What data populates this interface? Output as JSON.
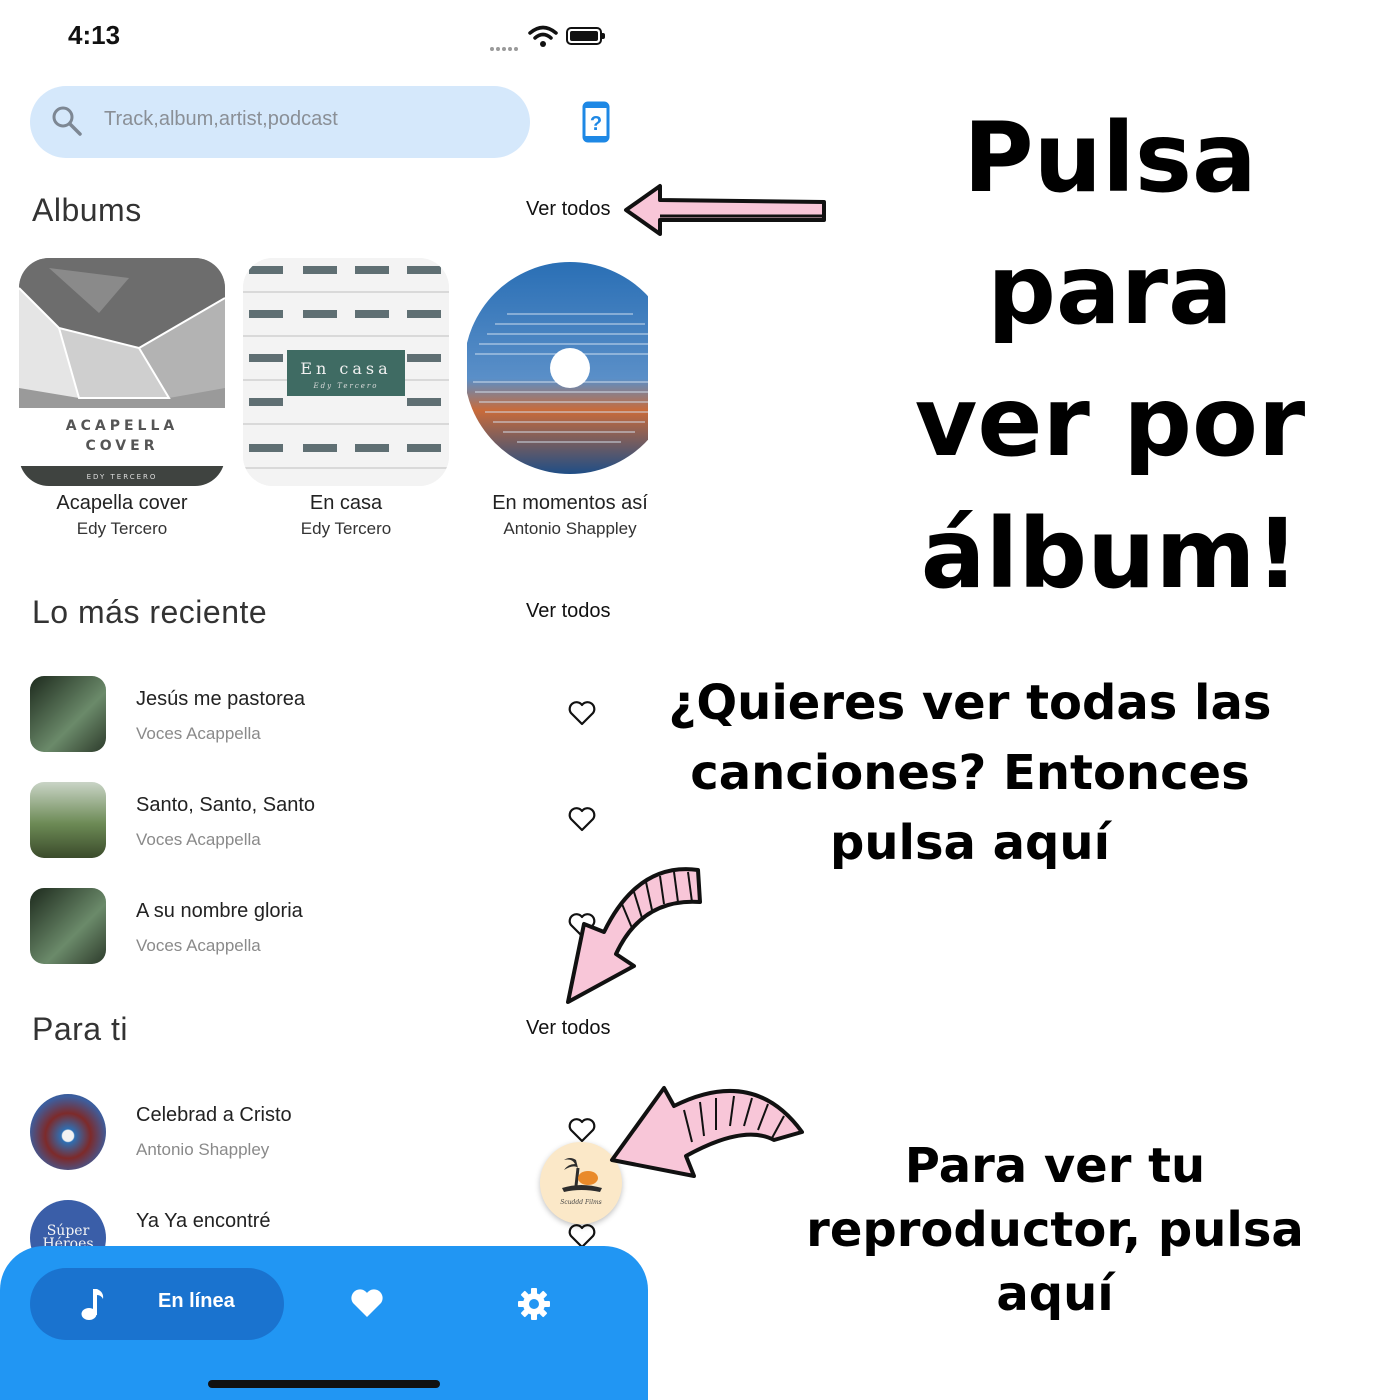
{
  "status_bar": {
    "time": "4:13"
  },
  "search": {
    "placeholder": "Track,album,artist,podcast"
  },
  "albums_section": {
    "title": "Albums",
    "see_all": "Ver todos",
    "items": [
      {
        "title": "Acapella cover",
        "artist": "Edy Tercero",
        "cover_line1": "ACAPELLA",
        "cover_line2": "COVER",
        "cover_footer": "EDY TERCERO"
      },
      {
        "title": "En casa",
        "artist": "Edy Tercero",
        "cover_title": "En casa",
        "cover_sub": "Edy Tercero"
      },
      {
        "title": "En momentos así",
        "artist": "Antonio Shappley"
      }
    ]
  },
  "recent_section": {
    "title": "Lo más reciente",
    "see_all": "Ver todos",
    "items": [
      {
        "title": "Jesús me pastorea",
        "artist": "Voces Acappella"
      },
      {
        "title": "Santo, Santo, Santo",
        "artist": "Voces Acappella"
      },
      {
        "title": "A su nombre gloria",
        "artist": "Voces Acappella"
      }
    ]
  },
  "for_you_section": {
    "title": "Para ti",
    "see_all": "Ver todos",
    "items": [
      {
        "title": "Celebrad a Cristo",
        "artist": "Antonio Shappley"
      },
      {
        "title": "Ya Ya encontré",
        "artist": "",
        "thumb_text": "Súper Héroes"
      }
    ]
  },
  "bottom_nav": {
    "online_label": "En línea"
  },
  "annotations": {
    "albums_line1": "Pulsa para",
    "albums_line2": "ver por",
    "albums_line3": "álbum!",
    "songs_line1": "¿Quieres ver todas las",
    "songs_line2": "canciones? Entonces",
    "songs_line3": "pulsa aquí",
    "player_line1": "Para ver tu",
    "player_line2": "reproductor, pulsa aquí"
  },
  "colors": {
    "accent": "#2196f3",
    "search_bg": "#d5e8fb",
    "arrow_pink": "#f8c6d8"
  }
}
